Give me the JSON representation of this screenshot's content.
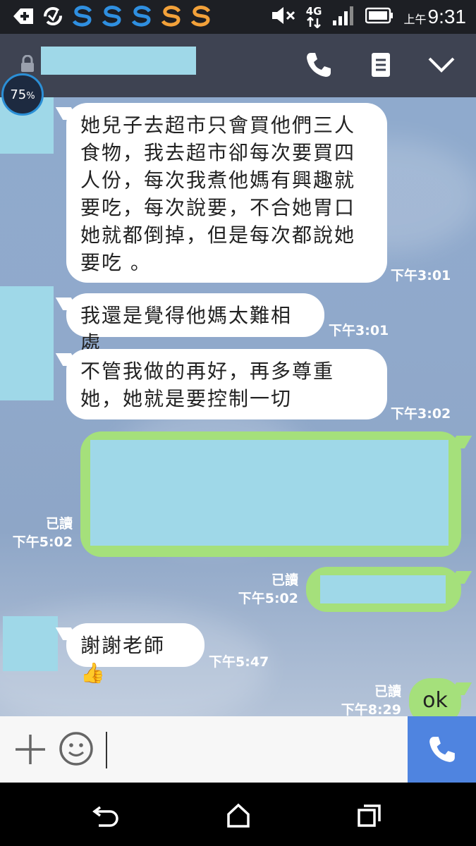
{
  "status_bar": {
    "network": "4G",
    "time_prefix": "上午",
    "time": "9:31"
  },
  "header": {
    "battery_badge": "75",
    "battery_unit": "%"
  },
  "messages": [
    {
      "side": "left",
      "text": "她兒子去超市只會買他們三人食物，我去超市卻每次要買四人份，每次我煮他媽有興趣就要吃，每次說要，不合她胃口她就都倒掉，但是每次都說她要吃 。",
      "time": "下午3:01"
    },
    {
      "side": "left",
      "text": "我還是覺得他媽太難相處",
      "time": "下午3:01"
    },
    {
      "side": "left",
      "text": "不管我做的再好，再多尊重她，她就是要控制一切",
      "time": "下午3:02"
    },
    {
      "side": "right",
      "text": "",
      "read": "已讀",
      "time": "下午5:02"
    },
    {
      "side": "right",
      "text": "",
      "read": "已讀",
      "time": "下午5:02"
    },
    {
      "side": "left",
      "text": "謝謝老師",
      "emoji": "👍",
      "time": "下午5:47"
    },
    {
      "side": "right",
      "text": "ok",
      "read": "已讀",
      "time": "下午8:29"
    }
  ],
  "input": {
    "placeholder": ""
  },
  "colors": {
    "header_bg": "#3e4352",
    "bubble_green": "#a5e07b",
    "call_button": "#4f84e0",
    "redaction": "#9fd8e8"
  }
}
